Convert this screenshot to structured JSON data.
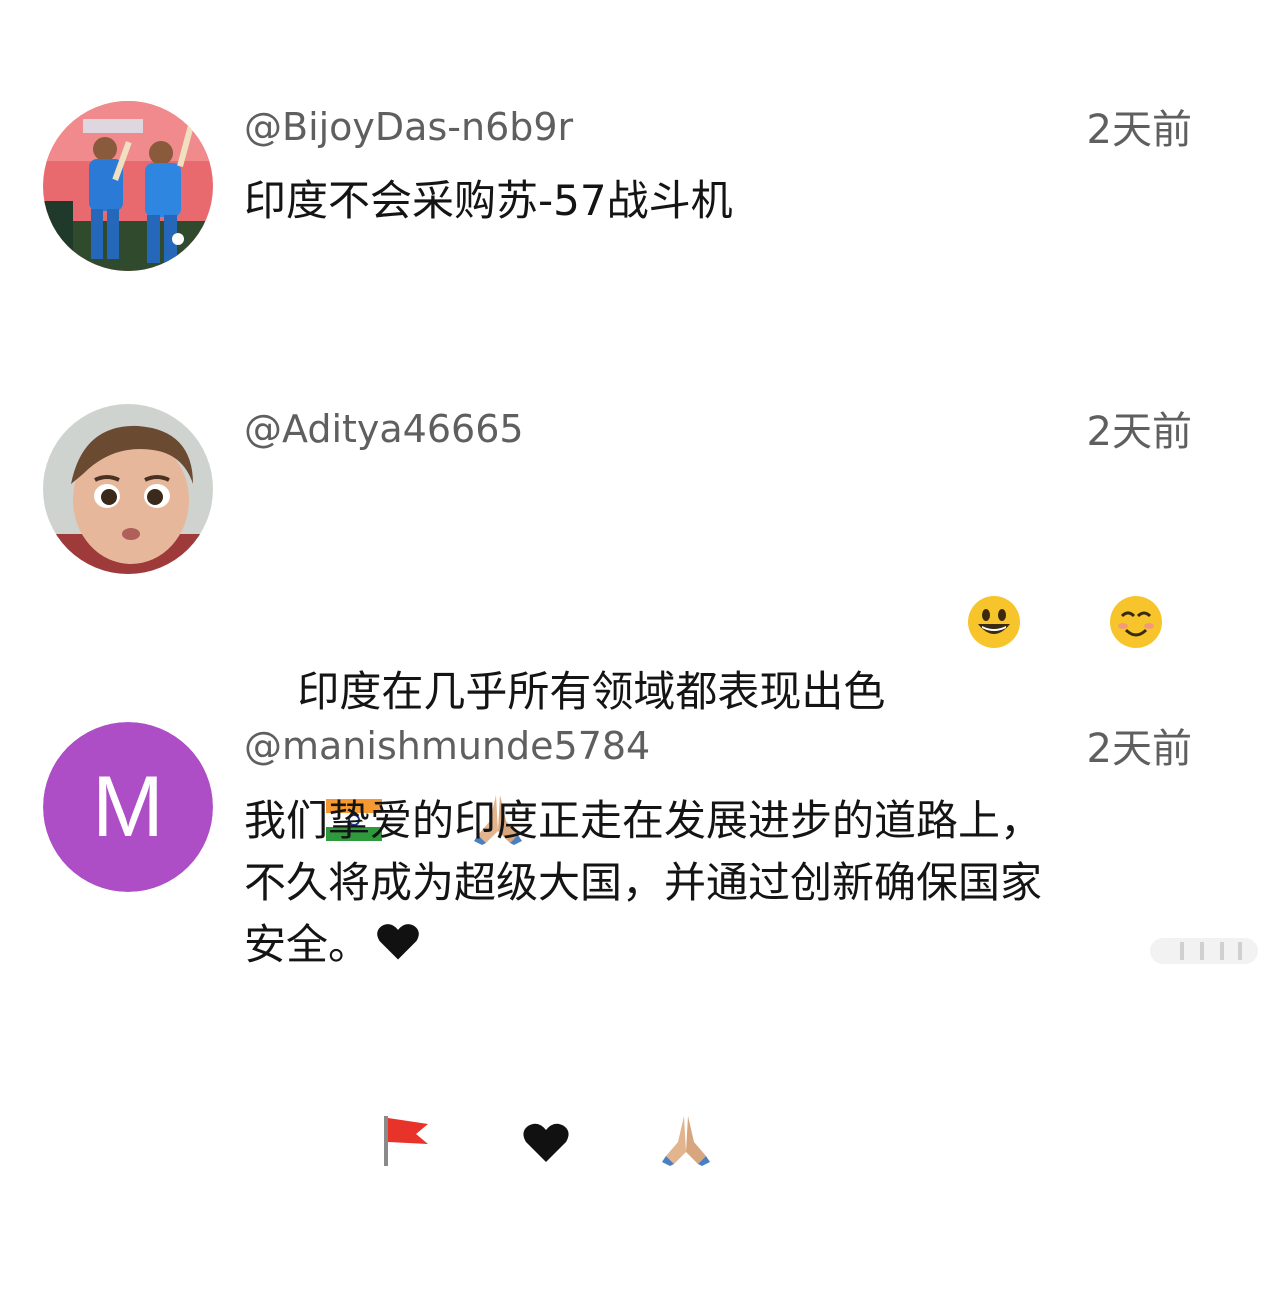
{
  "comments": [
    {
      "username": "@BijoyDas-n6b9r",
      "time": "2天前",
      "text": "印度不会采购苏-57战斗机",
      "avatar": {
        "type": "photo",
        "description_icon": "cricket-players-photo"
      }
    },
    {
      "username": "@Aditya46665",
      "time": "2天前",
      "text_line1": "印度在几乎所有领域都表现出色",
      "emojis_line1": [
        "grinning-face",
        "smiling-face",
        "india-flag",
        "folded-hands"
      ],
      "emojis_line2": [
        "red-flag",
        "black-heart",
        "folded-hands"
      ],
      "avatar": {
        "type": "photo",
        "description_icon": "cartoon-boy-photo"
      }
    },
    {
      "username": "@manishmunde5784",
      "time": "2天前",
      "text": "我们挚爱的印度正走在发展进步的道路上，\n不久将成为超级大国，并通过创新确保国家\n安全。",
      "trailing_emoji": "black-heart",
      "avatar": {
        "type": "letter",
        "letter": "M",
        "color": "#ae4ec7"
      }
    }
  ],
  "colors": {
    "username": "#5f5f5f",
    "timestamp": "#5f5f5f",
    "text": "#141414",
    "background": "#ffffff"
  }
}
